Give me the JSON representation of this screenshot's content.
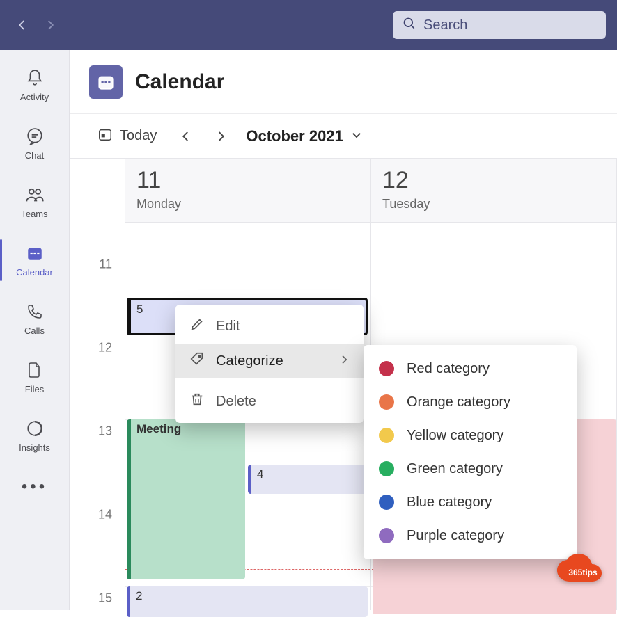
{
  "search": {
    "placeholder": "Search"
  },
  "rail": {
    "items": [
      {
        "key": "activity",
        "label": "Activity"
      },
      {
        "key": "chat",
        "label": "Chat"
      },
      {
        "key": "teams",
        "label": "Teams"
      },
      {
        "key": "calendar",
        "label": "Calendar"
      },
      {
        "key": "calls",
        "label": "Calls"
      },
      {
        "key": "files",
        "label": "Files"
      },
      {
        "key": "insights",
        "label": "Insights"
      }
    ]
  },
  "header": {
    "title": "Calendar"
  },
  "toolbar": {
    "today": "Today",
    "month": "October 2021"
  },
  "days": [
    {
      "num": "11",
      "name": "Monday"
    },
    {
      "num": "12",
      "name": "Tuesday"
    }
  ],
  "hours": [
    "11",
    "12",
    "13",
    "14",
    "15"
  ],
  "events": {
    "e1": {
      "label": "5"
    },
    "e2": {
      "label": "Meeting"
    },
    "e3": {
      "label": "4"
    },
    "e4": {
      "label": "2"
    }
  },
  "context_menu": {
    "edit": "Edit",
    "categorize": "Categorize",
    "delete": "Delete"
  },
  "categories": [
    {
      "label": "Red category",
      "color": "#c4314b"
    },
    {
      "label": "Orange category",
      "color": "#e97548"
    },
    {
      "label": "Yellow category",
      "color": "#f2c94c"
    },
    {
      "label": "Green category",
      "color": "#27ae60"
    },
    {
      "label": "Blue category",
      "color": "#2f5fbf"
    },
    {
      "label": "Purple category",
      "color": "#8f6bbf"
    }
  ],
  "watermark": {
    "text": "365tips"
  }
}
